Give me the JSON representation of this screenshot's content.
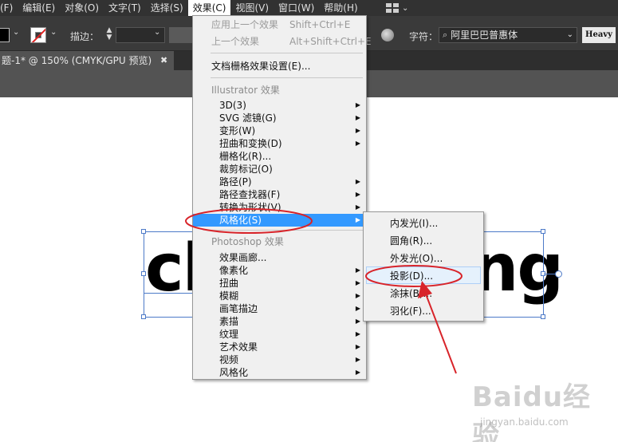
{
  "menubar": {
    "items": [
      "(F)",
      "编辑(E)",
      "对象(O)",
      "文字(T)",
      "选择(S)",
      "效果(C)",
      "视图(V)",
      "窗口(W)",
      "帮助(H)"
    ],
    "active_index": 5
  },
  "controlbar": {
    "stroke_label": "描边：",
    "font_label": "字符：",
    "font_family": "阿里巴巴普惠体",
    "font_weight": "Heavy"
  },
  "tab": {
    "title": "题-1* @ 150% (CMYK/GPU 预览)",
    "close": "✖"
  },
  "canvas": {
    "left_text": "cl",
    "right_text": "ng"
  },
  "effect_menu": {
    "top_items": [
      {
        "label": "应用上一个效果",
        "shortcut": "Shift+Ctrl+E",
        "enabled": false
      },
      {
        "label": "上一个效果",
        "shortcut": "Alt+Shift+Ctrl+E",
        "enabled": false
      },
      {
        "label": "文档栅格效果设置(E)...",
        "enabled": true
      }
    ],
    "illustrator_header": "Illustrator 效果",
    "illustrator_items": [
      {
        "label": "3D(3)",
        "submenu": true
      },
      {
        "label": "SVG 滤镜(G)",
        "submenu": true
      },
      {
        "label": "变形(W)",
        "submenu": true
      },
      {
        "label": "扭曲和变换(D)",
        "submenu": true
      },
      {
        "label": "栅格化(R)...",
        "submenu": false
      },
      {
        "label": "裁剪标记(O)",
        "submenu": false
      },
      {
        "label": "路径(P)",
        "submenu": true
      },
      {
        "label": "路径查找器(F)",
        "submenu": true
      },
      {
        "label": "转换为形状(V)",
        "submenu": true
      },
      {
        "label": "风格化(S)",
        "submenu": true,
        "highlighted": true
      }
    ],
    "photoshop_header": "Photoshop 效果",
    "photoshop_items": [
      {
        "label": "效果画廊...",
        "submenu": false
      },
      {
        "label": "像素化",
        "submenu": true
      },
      {
        "label": "扭曲",
        "submenu": true
      },
      {
        "label": "模糊",
        "submenu": true
      },
      {
        "label": "画笔描边",
        "submenu": true
      },
      {
        "label": "素描",
        "submenu": true
      },
      {
        "label": "纹理",
        "submenu": true
      },
      {
        "label": "艺术效果",
        "submenu": true
      },
      {
        "label": "视频",
        "submenu": true
      },
      {
        "label": "风格化",
        "submenu": true
      }
    ]
  },
  "stylize_submenu": {
    "items": [
      "内发光(I)...",
      "圆角(R)...",
      "外发光(O)...",
      "投影(D)...",
      "涂抹(B)...",
      "羽化(F)..."
    ],
    "hover_index": 3
  },
  "watermark": {
    "text": "Baidu经验",
    "url": "jingyan.baidu.com"
  },
  "colors": {
    "menubar_bg": "#323232",
    "highlight": "#3399ff",
    "annotation_red": "#d8242a",
    "selection_blue": "#4d7ac8"
  }
}
